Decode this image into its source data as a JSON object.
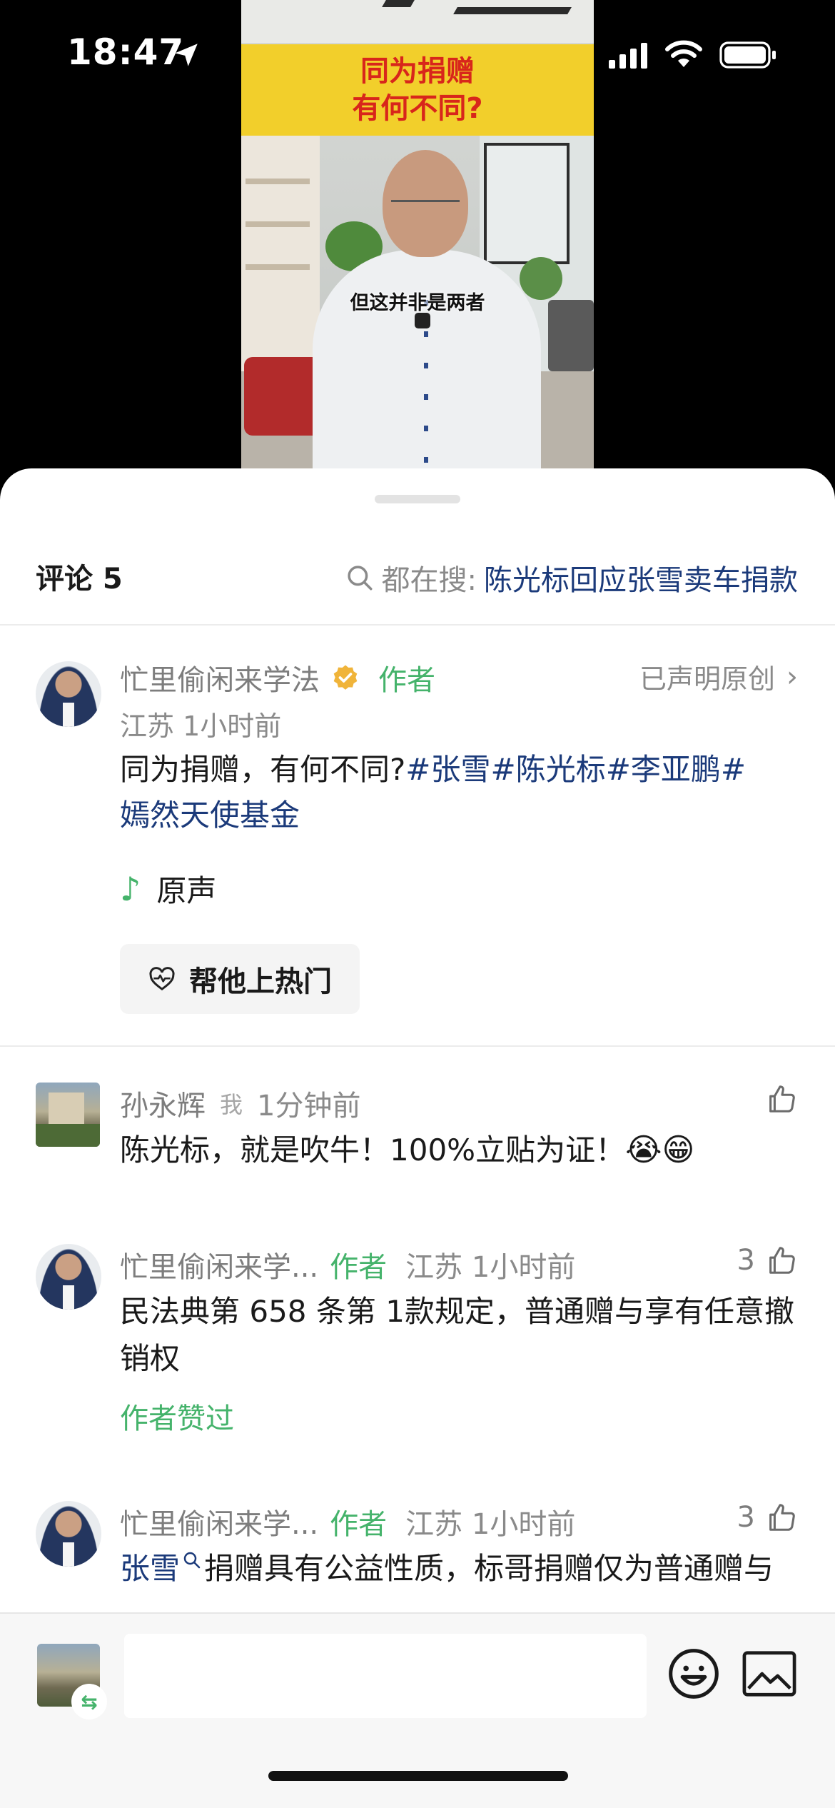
{
  "status_bar": {
    "time": "18:47"
  },
  "video": {
    "title_line1": "同为捐赠",
    "title_line2": "有何不同?",
    "subtitle": "但这并非是两者"
  },
  "comments_header": {
    "count_label": "评论 5",
    "search_label": "都在搜:",
    "search_term": "陈光标回应张雪卖车捐款"
  },
  "post": {
    "author": "忙里偷闲来学法",
    "author_tag": "作者",
    "original_label": "已声明原创",
    "meta": "江苏 1小时前",
    "text_plain": "同为捐赠，有何不同?",
    "tags": [
      "#张雪",
      "#陈光标",
      "#李亚鹏#",
      "嫣然天使基金"
    ],
    "audio": "原声",
    "boost_label": "帮他上热门"
  },
  "comments": [
    {
      "name": "孙永辉",
      "me_tag": "我",
      "time": "1分钟前",
      "text": "陈光标，就是吹牛！100%立贴为证！",
      "emojis": "😭😁"
    },
    {
      "name": "忙里偷闲来学...",
      "author_tag": "作者",
      "loc_time": "江苏 1小时前",
      "likes": "3",
      "text": "民法典第 658 条第 1款规定，普通赠与享有任意撤销权",
      "liked_by_author": "作者赞过"
    },
    {
      "name": "忙里偷闲来学...",
      "author_tag": "作者",
      "loc_time": "江苏 1小时前",
      "likes": "3",
      "mention": "张雪",
      "text": "捐赠具有公益性质，标哥捐赠仅为普通赠与"
    }
  ],
  "input_bar": {
    "switch_glyph": "⇆"
  },
  "colors": {
    "accent_green": "#45b36b",
    "link_blue": "#1b3a7a",
    "banner_yellow": "#f2cf2b",
    "banner_red": "#d8261b"
  }
}
